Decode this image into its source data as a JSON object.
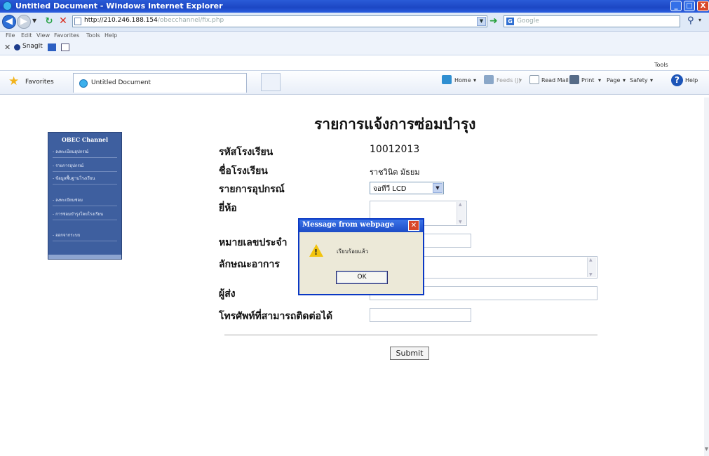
{
  "window": {
    "title": "Untitled Document - Windows Internet Explorer",
    "min": "_",
    "max": "□",
    "close": "X"
  },
  "addressbar": {
    "url_host": "http://210.246.188.154",
    "url_path": "/obecchannel/fix.php",
    "search_placeholder": "Google"
  },
  "menubar": {
    "items": [
      "File",
      "Edit",
      "View",
      "Favorites",
      "Tools",
      "Help"
    ]
  },
  "snagit": {
    "label": "SnagIt"
  },
  "favbar": {
    "favorites_label": "Favorites",
    "tab_title": "Untitled Document",
    "commands": {
      "home": "Home",
      "feeds": "Feeds (J)",
      "read_mail": "Read Mail",
      "print": "Print",
      "page": "Page",
      "safety": "Safety",
      "tools": "Tools",
      "help": "Help"
    }
  },
  "sidebar": {
    "title": "OBEC Channel",
    "items": [
      "- ลงทะเบียนอุปกรณ์",
      "- รายการอุปกรณ์",
      "- ข้อมูลพื้นฐานโรงเรียน",
      "- ลงทะเบียนซ่อม",
      "- การซ่อมบำรุงโดยโรงเรียน",
      "- ออกจากระบบ"
    ]
  },
  "form": {
    "title": "รายการแจ้งการซ่อมบำรุง",
    "school_code_label": "รหัสโรงเรียน",
    "school_code_value": "10012013",
    "school_name_label": "ชื่อโรงเรียน",
    "school_name_value": "ราชวินิต มัธยม",
    "equipment_label": "รายการอุปกรณ์",
    "equipment_value": "จอทีวี LCD",
    "brand_label": "ยี่ห้อ",
    "serial_label": "หมายเลขประจำ",
    "symptom_label": "ลักษณะอาการ",
    "sender_label": "ผู้ส่ง",
    "phone_label": "โทรศัพท์ที่สามารถติดต่อได้",
    "submit_label": "Submit"
  },
  "dialog": {
    "title": "Message from webpage",
    "message": "เรียบร้อยแล้ว",
    "ok_label": "OK"
  }
}
